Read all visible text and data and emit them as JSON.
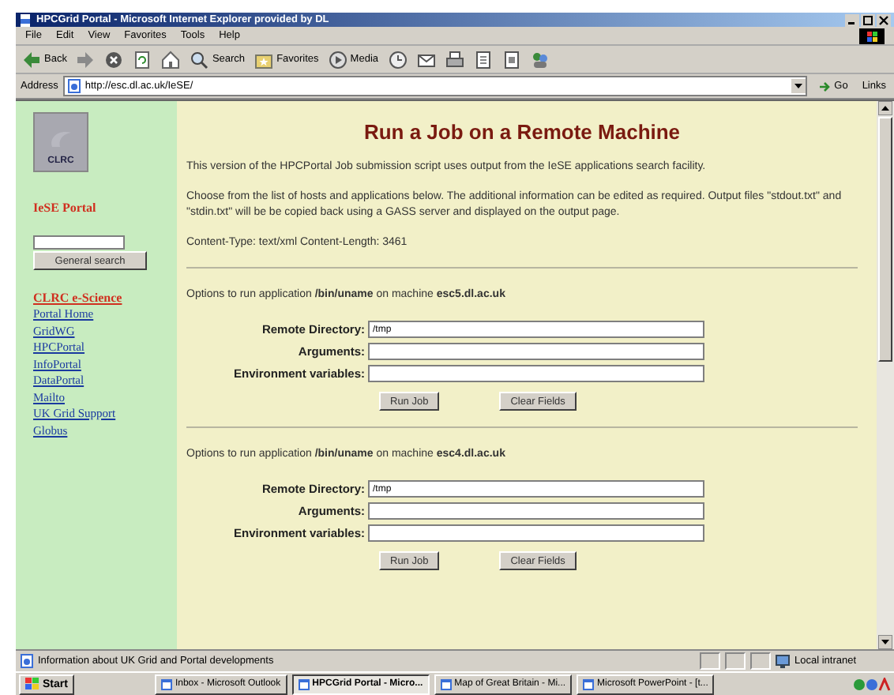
{
  "window": {
    "title": "HPCGrid Portal - Microsoft Internet Explorer provided by DL"
  },
  "menu": [
    "File",
    "Edit",
    "View",
    "Favorites",
    "Tools",
    "Help"
  ],
  "toolbar": [
    {
      "kind": "back",
      "label": "Back"
    },
    {
      "kind": "forward"
    },
    {
      "kind": "stop"
    },
    {
      "kind": "refresh"
    },
    {
      "kind": "home"
    },
    {
      "kind": "search",
      "label": "Search"
    },
    {
      "kind": "favorites",
      "label": "Favorites"
    },
    {
      "kind": "media",
      "label": "Media"
    },
    {
      "kind": "history"
    },
    {
      "kind": "mail"
    },
    {
      "kind": "print"
    },
    {
      "kind": "edit"
    },
    {
      "kind": "discuss"
    },
    {
      "kind": "messenger"
    }
  ],
  "address": {
    "label": "Address",
    "value": "http://esc.dl.ac.uk/IeSE/",
    "go": "Go",
    "links": "Links"
  },
  "sidebar": {
    "logo": "CLRC",
    "title": "IeSE Portal",
    "search_button": "General search",
    "section": "CLRC e-Science",
    "links": [
      "Portal Home",
      "GridWG",
      "HPCPortal",
      "InfoPortal",
      "DataPortal",
      "Mailto",
      "UK Grid Support",
      "Globus"
    ]
  },
  "main": {
    "heading": "Run a Job on a Remote Machine",
    "paragraphs": [
      "This version of the HPCPortal Job submission script uses output from the IeSE applications search facility.",
      "Choose from the list of hosts and applications below. The additional information can be edited as required. Output files \"stdout.txt\" and \"stdin.txt\" will be be copied back using a GASS server and displayed on the output page.",
      "Content-Type: text/xml Content-Length: 3461"
    ],
    "jobs": [
      {
        "intro": "Options to run application **/bin/uname** on machine **esc5.dl.ac.uk**",
        "fields": [
          {
            "label": "Remote Directory:",
            "value": "/tmp"
          },
          {
            "label": "Arguments:"
          },
          {
            "label": "Environment variables:"
          }
        ],
        "buttons": [
          "Run Job",
          "Clear Fields"
        ]
      },
      {
        "intro": "Options to run application **/bin/uname** on machine **esc4.dl.ac.uk**",
        "fields": [
          {
            "label": "Remote Directory:",
            "value": "/tmp"
          },
          {
            "label": "Arguments:"
          },
          {
            "label": "Environment variables:"
          }
        ],
        "buttons": [
          "Run Job",
          "Clear Fields"
        ]
      }
    ]
  },
  "status_bar": {
    "text": "Information about UK Grid and Portal developments",
    "zone": "Local intranet"
  },
  "taskbar": {
    "start": "Start",
    "tasks": [
      {
        "label": "Inbox - Microsoft Outlook",
        "selected": false
      },
      {
        "label": "HPCGrid Portal - Micro...",
        "selected": true
      },
      {
        "label": "Map of Great Britain - Mi...",
        "selected": false
      },
      {
        "label": "Microsoft PowerPoint - [t...",
        "selected": false
      }
    ]
  }
}
